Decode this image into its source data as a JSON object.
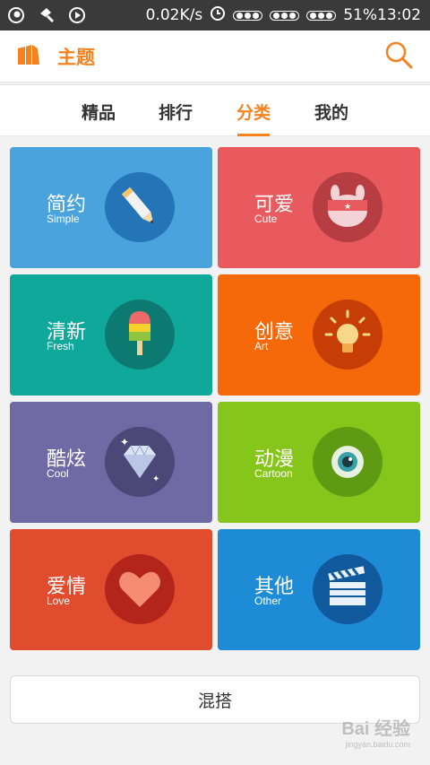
{
  "status_bar": {
    "net_speed": "0.02K/s",
    "battery": "51%",
    "time": "13:02"
  },
  "header": {
    "title": "主题"
  },
  "tabs": [
    {
      "label": "精品",
      "active": false
    },
    {
      "label": "排行",
      "active": false
    },
    {
      "label": "分类",
      "active": true
    },
    {
      "label": "我的",
      "active": false
    }
  ],
  "categories": [
    {
      "cn": "简约",
      "en": "Simple",
      "color": "#4aa3dc",
      "badge": "#2474b8",
      "icon": "pencil-icon"
    },
    {
      "cn": "可爱",
      "en": "Cute",
      "color": "#e85a5e",
      "badge": "#b63d41",
      "icon": "bunny-icon"
    },
    {
      "cn": "清新",
      "en": "Fresh",
      "color": "#11a89c",
      "badge": "#0d7a72",
      "icon": "popsicle-icon"
    },
    {
      "cn": "创意",
      "en": "Art",
      "color": "#f5690a",
      "badge": "#c63e06",
      "icon": "lightbulb-icon"
    },
    {
      "cn": "酷炫",
      "en": "Cool",
      "color": "#6f6aa3",
      "badge": "#4b4777",
      "icon": "diamond-icon"
    },
    {
      "cn": "动漫",
      "en": "Cartoon",
      "color": "#86c519",
      "badge": "#5f9b12",
      "icon": "monster-eye-icon"
    },
    {
      "cn": "爱情",
      "en": "Love",
      "color": "#e24c2e",
      "badge": "#b3251a",
      "icon": "heart-icon"
    },
    {
      "cn": "其他",
      "en": "Other",
      "color": "#1e8bd6",
      "badge": "#10599c",
      "icon": "clapperboard-icon"
    }
  ],
  "mix_button": {
    "label": "混搭"
  },
  "watermark": {
    "text": "Bai 经验",
    "sub": "jingyan.baidu.com"
  }
}
